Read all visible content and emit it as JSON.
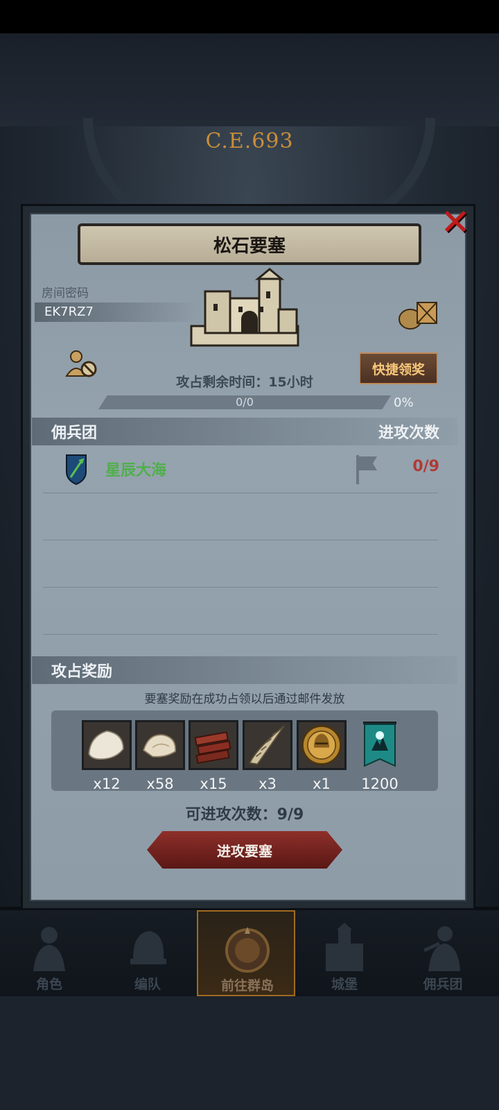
{
  "era": "C.E.693",
  "dialog": {
    "title": "松石要塞",
    "close_icon": "close-x-icon",
    "room_label": "房间密码",
    "room_code": "EK7RZ7",
    "quick_claim_label": "快捷领奖",
    "remaining_time": "攻占剩余时间：15小时",
    "progress_text": "0/0",
    "progress_percent": "0%",
    "progress_fraction": 0
  },
  "mercenary_section": {
    "title": "佣兵团",
    "right_label": "进攻次数",
    "rows": [
      {
        "name": "星辰大海",
        "count": "0/9",
        "icon": "shield-sword-icon"
      }
    ]
  },
  "reward_section": {
    "title": "攻占奖励",
    "note": "要塞奖励在成功占领以后通过邮件发放",
    "items": [
      {
        "icon": "fur-pelt-icon",
        "qty": "x12"
      },
      {
        "icon": "hide-leather-icon",
        "qty": "x58"
      },
      {
        "icon": "wood-planks-icon",
        "qty": "x15"
      },
      {
        "icon": "horn-icon",
        "qty": "x3"
      },
      {
        "icon": "knight-helmet-coin-icon",
        "qty": "x1"
      },
      {
        "icon": "guild-banner-icon",
        "qty": "1200"
      }
    ]
  },
  "attack_count_text": "可进攻次数：9/9",
  "attack_button_label": "进攻要塞",
  "bottom_nav": [
    {
      "label": "角色",
      "icon": "knight-icon",
      "active": false
    },
    {
      "label": "编队",
      "icon": "helmet-icon",
      "active": false
    },
    {
      "label": "前往群岛",
      "icon": "compass-map-icon",
      "active": true
    },
    {
      "label": "城堡",
      "icon": "castle-icon",
      "active": false
    },
    {
      "label": "佣兵团",
      "icon": "warrior-icon",
      "active": false
    }
  ],
  "colors": {
    "accent_gold": "#d7a04b",
    "merc_name_green": "#4fb04a",
    "count_red": "#b03a36",
    "close_red": "#c01a1a"
  }
}
